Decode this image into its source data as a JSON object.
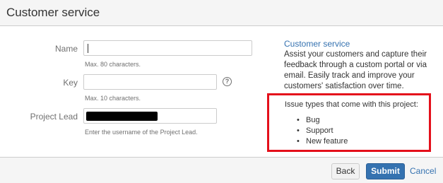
{
  "dialog": {
    "title": "Customer service"
  },
  "form": {
    "name": {
      "label": "Name",
      "value": "",
      "hint": "Max. 80 characters."
    },
    "key": {
      "label": "Key",
      "value": "",
      "hint": "Max. 10 characters.",
      "help_icon": "question-circle-icon"
    },
    "project_lead": {
      "label": "Project Lead",
      "value": "[redacted]",
      "hint": "Enter the username of the Project Lead."
    }
  },
  "sidebar": {
    "title": "Customer service",
    "description": "Assist your customers and capture their feedback through a custom portal or via email. Easily track and improve your customers' satisfaction over time.",
    "issue_types_heading": "Issue types that come with this project:",
    "issue_types": [
      "Bug",
      "Support",
      "New feature"
    ]
  },
  "footer": {
    "back_label": "Back",
    "submit_label": "Submit",
    "cancel_label": "Cancel"
  },
  "colors": {
    "accent": "#3572b0",
    "highlight": "#e4101b",
    "header_bg": "#f5f5f5"
  }
}
